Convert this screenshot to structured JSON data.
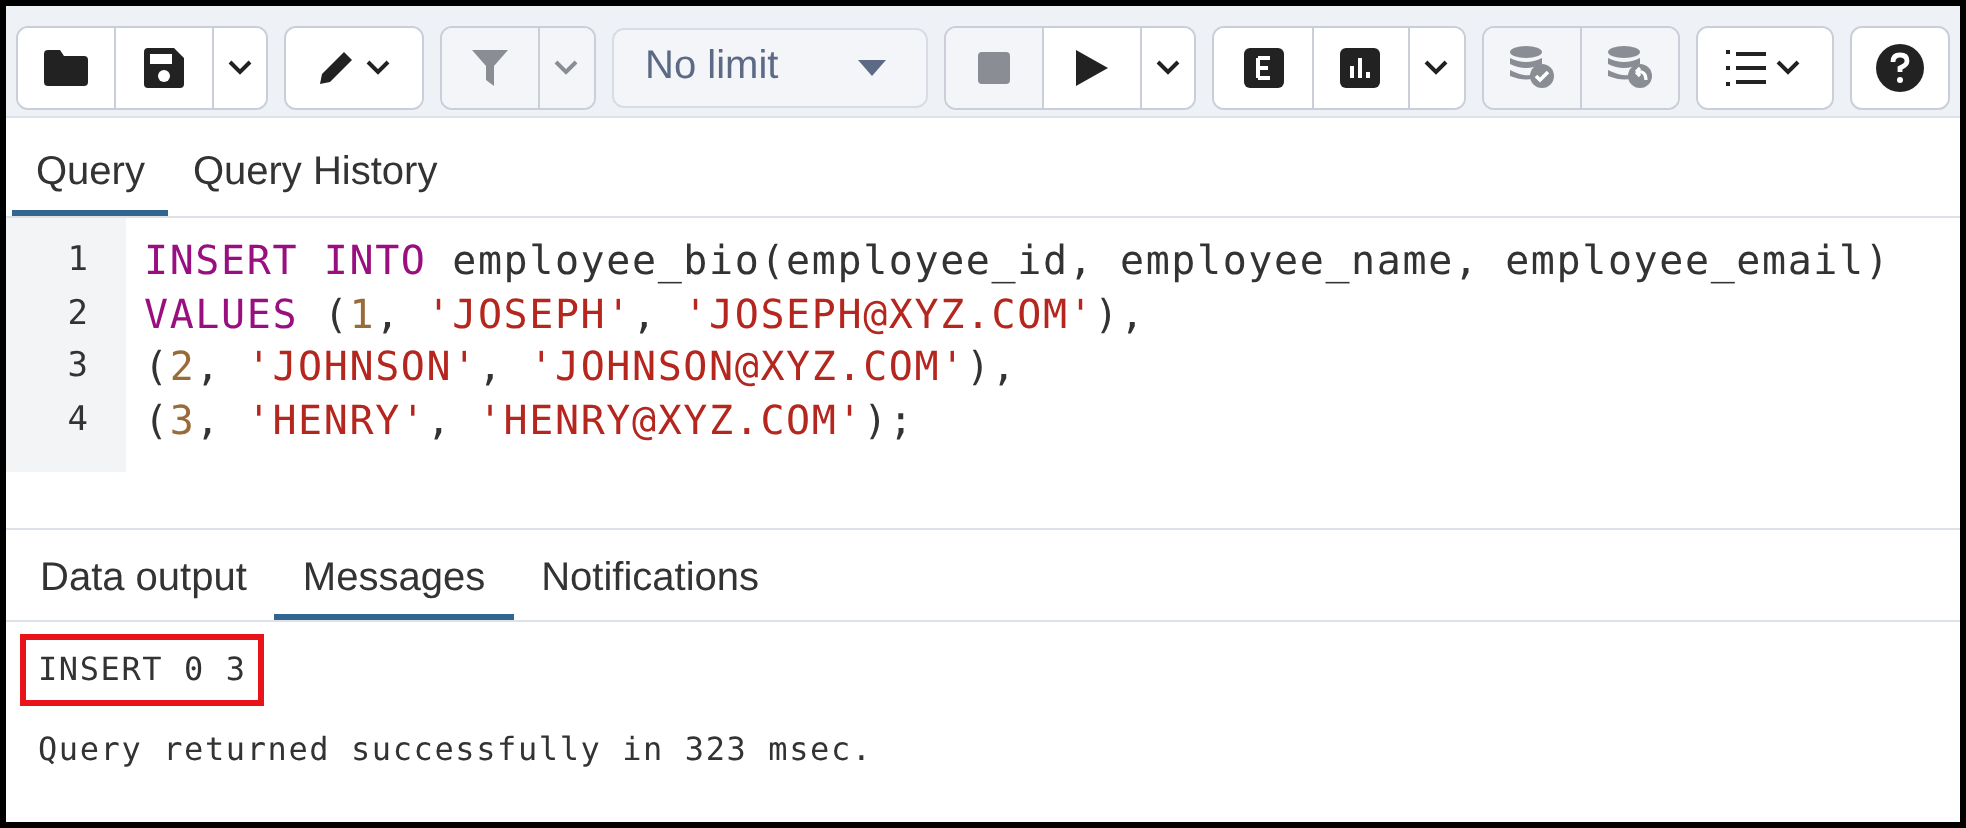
{
  "toolbar": {
    "groups": [
      {
        "buttons": [
          {
            "disabled": false
          },
          {
            "disabled": false
          },
          {
            "disabled": false
          }
        ]
      },
      {
        "buttons": [
          {
            "disabled": false
          }
        ]
      },
      {
        "buttons": [
          {
            "disabled": true
          },
          {
            "disabled": true
          }
        ]
      },
      {
        "buttons": [
          {
            "disabled": true
          },
          {
            "disabled": false
          },
          {
            "disabled": false
          }
        ]
      },
      {
        "buttons": [
          {
            "disabled": false
          },
          {
            "disabled": false
          },
          {
            "disabled": false
          }
        ]
      },
      {
        "buttons": [
          {
            "disabled": true
          },
          {
            "disabled": true
          }
        ]
      },
      {
        "buttons": [
          {
            "disabled": false
          }
        ]
      },
      {
        "buttons": [
          {
            "disabled": false
          }
        ]
      }
    ],
    "limit": {
      "value": "No limit"
    }
  },
  "editor_tabs": [
    {
      "label": "Query",
      "selected": true
    },
    {
      "label": "Query History",
      "selected": false
    }
  ],
  "editor": {
    "lines": [
      {
        "number": "1",
        "tokens": [
          {
            "kind": "keyword",
            "text": "INSERT INTO"
          },
          {
            "kind": "plain",
            "text": " employee_bio(employee_id, employee_name, employee_email)"
          }
        ]
      },
      {
        "number": "2",
        "tokens": [
          {
            "kind": "keyword",
            "text": "VALUES"
          },
          {
            "kind": "plain",
            "text": " ("
          },
          {
            "kind": "number",
            "text": "1"
          },
          {
            "kind": "plain",
            "text": ", "
          },
          {
            "kind": "string",
            "text": "'JOSEPH'"
          },
          {
            "kind": "plain",
            "text": ", "
          },
          {
            "kind": "string",
            "text": "'JOSEPH@XYZ.COM'"
          },
          {
            "kind": "plain",
            "text": "),"
          }
        ]
      },
      {
        "number": "3",
        "tokens": [
          {
            "kind": "plain",
            "text": "("
          },
          {
            "kind": "number",
            "text": "2"
          },
          {
            "kind": "plain",
            "text": ", "
          },
          {
            "kind": "string",
            "text": "'JOHNSON'"
          },
          {
            "kind": "plain",
            "text": ", "
          },
          {
            "kind": "string",
            "text": "'JOHNSON@XYZ.COM'"
          },
          {
            "kind": "plain",
            "text": "),"
          }
        ]
      },
      {
        "number": "4",
        "tokens": [
          {
            "kind": "plain",
            "text": "("
          },
          {
            "kind": "number",
            "text": "3"
          },
          {
            "kind": "plain",
            "text": ", "
          },
          {
            "kind": "string",
            "text": "'HENRY'"
          },
          {
            "kind": "plain",
            "text": ", "
          },
          {
            "kind": "string",
            "text": "'HENRY@XYZ.COM'"
          },
          {
            "kind": "plain",
            "text": ");"
          }
        ]
      }
    ]
  },
  "output_tabs": [
    {
      "label": "Data output",
      "selected": false
    },
    {
      "label": "Messages",
      "selected": true
    },
    {
      "label": "Notifications",
      "selected": false
    }
  ],
  "messages": [
    {
      "text": "INSERT 0 3",
      "highlighted": true
    },
    {
      "text": "Query returned successfully in 323 msec.",
      "highlighted": false
    }
  ]
}
